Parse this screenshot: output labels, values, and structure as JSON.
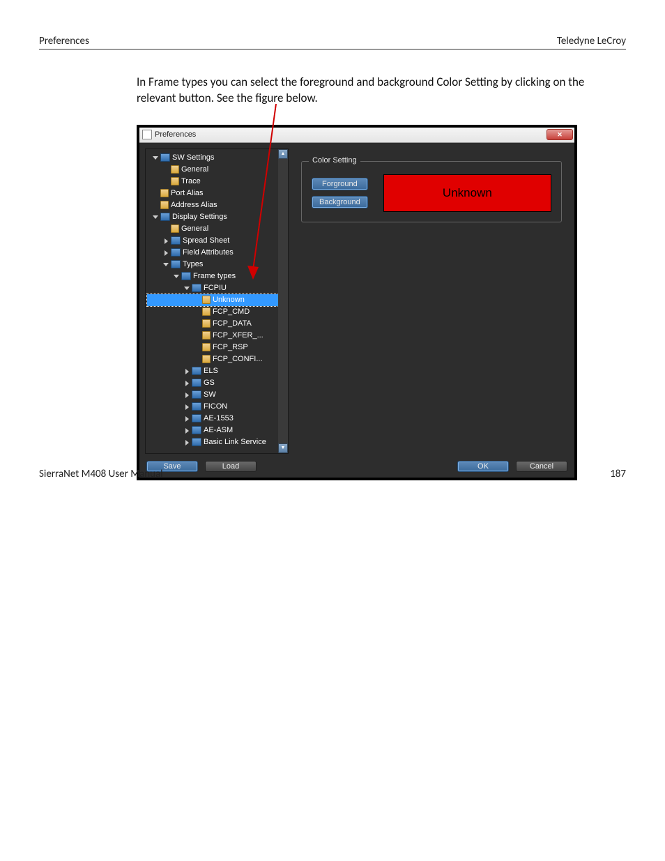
{
  "doc": {
    "header_left": "Preferences",
    "header_right": "Teledyne LeCroy",
    "body_text": "In Frame types you can select the foreground and background Color Setting by clicking on the relevant button. See the figure below.",
    "footer_left": "SierraNet M408 User Manual",
    "page_number": "187"
  },
  "dialog": {
    "title": "Preferences",
    "group_title": "Color Setting",
    "buttons": {
      "foreground": "Forground",
      "background": "Background",
      "save": "Save",
      "load": "Load",
      "ok": "OK",
      "cancel": "Cancel"
    },
    "preview_text": "Unknown",
    "preview_bg": "#e00000",
    "preview_fg": "#000000"
  },
  "tree": [
    {
      "depth": 0,
      "exp": "down",
      "icon": "folder",
      "label": "SW Settings"
    },
    {
      "depth": 1,
      "exp": "none",
      "icon": "leaf",
      "label": "General"
    },
    {
      "depth": 1,
      "exp": "none",
      "icon": "leaf",
      "label": "Trace"
    },
    {
      "depth": 0,
      "exp": "none",
      "icon": "leaf",
      "label": "Port Alias"
    },
    {
      "depth": 0,
      "exp": "none",
      "icon": "leaf",
      "label": "Address Alias"
    },
    {
      "depth": 0,
      "exp": "down",
      "icon": "folder",
      "label": "Display Settings"
    },
    {
      "depth": 1,
      "exp": "none",
      "icon": "leaf",
      "label": "General"
    },
    {
      "depth": 1,
      "exp": "right",
      "icon": "folder",
      "label": "Spread Sheet"
    },
    {
      "depth": 1,
      "exp": "right",
      "icon": "folder",
      "label": "Field Attributes"
    },
    {
      "depth": 1,
      "exp": "down",
      "icon": "folder",
      "label": "Types"
    },
    {
      "depth": 2,
      "exp": "down",
      "icon": "folder",
      "label": "Frame types"
    },
    {
      "depth": 3,
      "exp": "down",
      "icon": "folder",
      "label": "FCPIU"
    },
    {
      "depth": 4,
      "exp": "none",
      "icon": "leaf",
      "label": "Unknown",
      "selected": true
    },
    {
      "depth": 4,
      "exp": "none",
      "icon": "leaf",
      "label": "FCP_CMD"
    },
    {
      "depth": 4,
      "exp": "none",
      "icon": "leaf",
      "label": "FCP_DATA"
    },
    {
      "depth": 4,
      "exp": "none",
      "icon": "leaf",
      "label": "FCP_XFER_..."
    },
    {
      "depth": 4,
      "exp": "none",
      "icon": "leaf",
      "label": "FCP_RSP"
    },
    {
      "depth": 4,
      "exp": "none",
      "icon": "leaf",
      "label": "FCP_CONFI..."
    },
    {
      "depth": 3,
      "exp": "right",
      "icon": "folder",
      "label": "ELS"
    },
    {
      "depth": 3,
      "exp": "right",
      "icon": "folder",
      "label": "GS"
    },
    {
      "depth": 3,
      "exp": "right",
      "icon": "folder",
      "label": "SW"
    },
    {
      "depth": 3,
      "exp": "right",
      "icon": "folder",
      "label": "FICON"
    },
    {
      "depth": 3,
      "exp": "right",
      "icon": "folder",
      "label": "AE-1553"
    },
    {
      "depth": 3,
      "exp": "right",
      "icon": "folder",
      "label": "AE-ASM"
    },
    {
      "depth": 3,
      "exp": "right",
      "icon": "folder",
      "label": "Basic Link Service"
    }
  ]
}
